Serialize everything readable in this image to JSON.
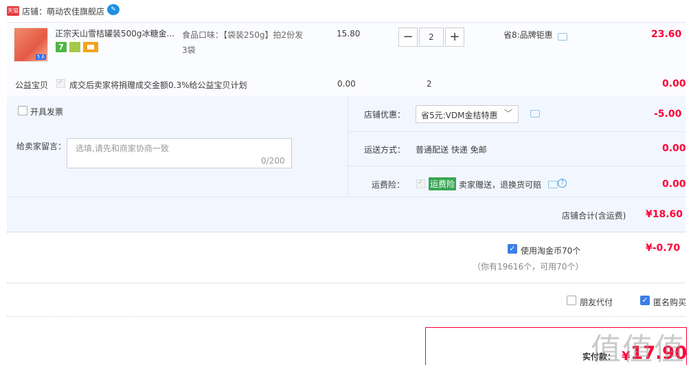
{
  "shop": {
    "name": "店铺：萌动农佳旗舰店",
    "logo_text": "天猫"
  },
  "product": {
    "title": "正宗天山雪桔罐装500g冰糖金...",
    "spec": "食品口味：【袋装250g】拍2份发3袋",
    "unit_price": "15.80",
    "quantity": "2",
    "promo": "省8:品牌钜惠",
    "subtotal": "23.60",
    "thumb_tag": "5.6",
    "badge_7": "7"
  },
  "charity": {
    "label": "公益宝贝",
    "text": "成交后卖家将捐赠成交金额0.3%给公益宝贝计划",
    "price": "0.00",
    "qty": "2",
    "total": "0.00"
  },
  "options": {
    "invoice_label": "开具发票",
    "message_label": "给卖家留言：",
    "message_placeholder": "选填,请先和商家协商一致",
    "message_counter": "0/200",
    "coupon_label": "店铺优惠：",
    "coupon_value": "省5元:VDM金桔特惠",
    "coupon_discount": "-5.00",
    "ship_label": "运送方式：",
    "ship_value": "普通配送 快递 免邮",
    "ship_price": "0.00",
    "ins_label": "运费险：",
    "ins_badge": "运费险",
    "ins_text": "卖家赠送，退换货可赔",
    "ins_price": "0.00",
    "shop_total_label": "店铺合计(含运费)",
    "shop_total_value": "¥18.60"
  },
  "coins": {
    "label": "使用淘金币70个",
    "value": "¥-0.70",
    "note": "（你有19616个，可用70个）"
  },
  "extras": {
    "friend_label": "朋友代付",
    "anon_label": "匿名购买"
  },
  "payment": {
    "label": "实付款：",
    "symbol": "¥",
    "value": "17.90"
  },
  "watermark": "值值值",
  "colors": {
    "accent": "#ff0036",
    "panel": "#f2f7ff",
    "check": "#3c7ee6"
  }
}
